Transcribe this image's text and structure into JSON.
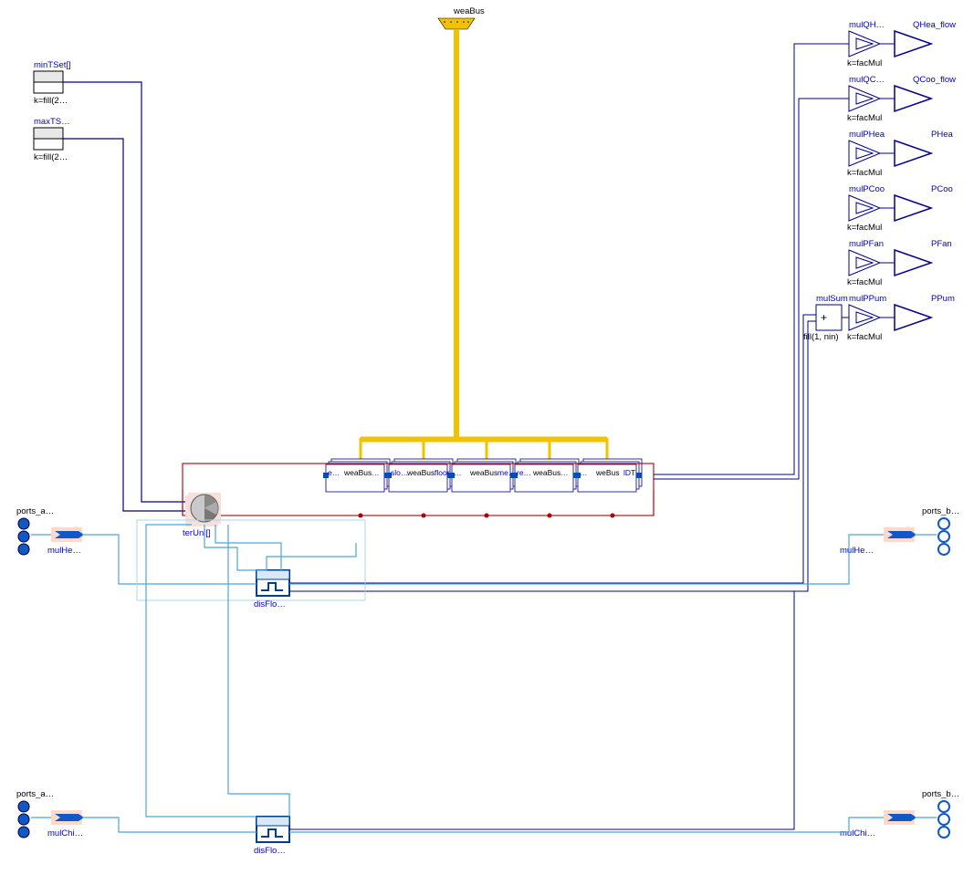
{
  "bus": {
    "label": "weaBus"
  },
  "left_blocks": {
    "minTSet": {
      "label": "minTSet[]",
      "sub": "k=fill(2…"
    },
    "maxTS": {
      "label": "maxTS…",
      "sub": "k=fill(2…"
    }
  },
  "right_outputs": {
    "qhea": {
      "mul": "mulQH…",
      "sub": "k=facMul",
      "out": "QHea_flow"
    },
    "qcoo": {
      "mul": "mulQC…",
      "sub": "k=facMul",
      "out": "QCoo_flow"
    },
    "phea": {
      "mul": "mulPHea",
      "sub": "k=facMul",
      "out": "PHea"
    },
    "pcoo": {
      "mul": "mulPCoo",
      "sub": "k=facMul",
      "out": "PCoo"
    },
    "pfan": {
      "mul": "mulPFan",
      "sub": "k=facMul",
      "out": "PFan"
    },
    "ppum": {
      "mul": "mulPPum",
      "sub": "k=facMul",
      "out": "PPum",
      "sum_label": "mulSum",
      "sum_sub": "fill(1, nin)",
      "sum_plus": "+"
    }
  },
  "zone_row": {
    "items": [
      {
        "left": "e…",
        "bus": "weaBus",
        "right": "…"
      },
      {
        "left": "slo…",
        "bus": "weaBus",
        "right": "floor"
      },
      {
        "left": "…",
        "bus": "weaBus",
        "right": "me…"
      },
      {
        "left": "re…",
        "bus": "weaBus",
        "right": "…"
      },
      {
        "left": "…",
        "bus": "weBus",
        "right": "lDT"
      }
    ]
  },
  "ter": {
    "label": "terUni[]"
  },
  "dis1": {
    "label": "disFlo…"
  },
  "dis2": {
    "label": "disFlo…"
  },
  "ports": {
    "left_top": {
      "label": "ports_a…",
      "mul": "mulHe…"
    },
    "left_bot": {
      "label": "ports_a…",
      "mul": "mulChi…"
    },
    "right_top": {
      "label": "ports_b…",
      "mul": "mulHe…"
    },
    "right_bot": {
      "label": "ports_b…",
      "mul": "mulChi…"
    }
  },
  "colors": {
    "yellow": "#f2c200",
    "darkblue": "#00008b",
    "red": "#b00000",
    "cyan": "#4aa8d8",
    "lightcy": "#a8d4ee",
    "pale": "#ffd9cc",
    "salmon": "#f7e0dc",
    "blue": "#0000cc"
  }
}
